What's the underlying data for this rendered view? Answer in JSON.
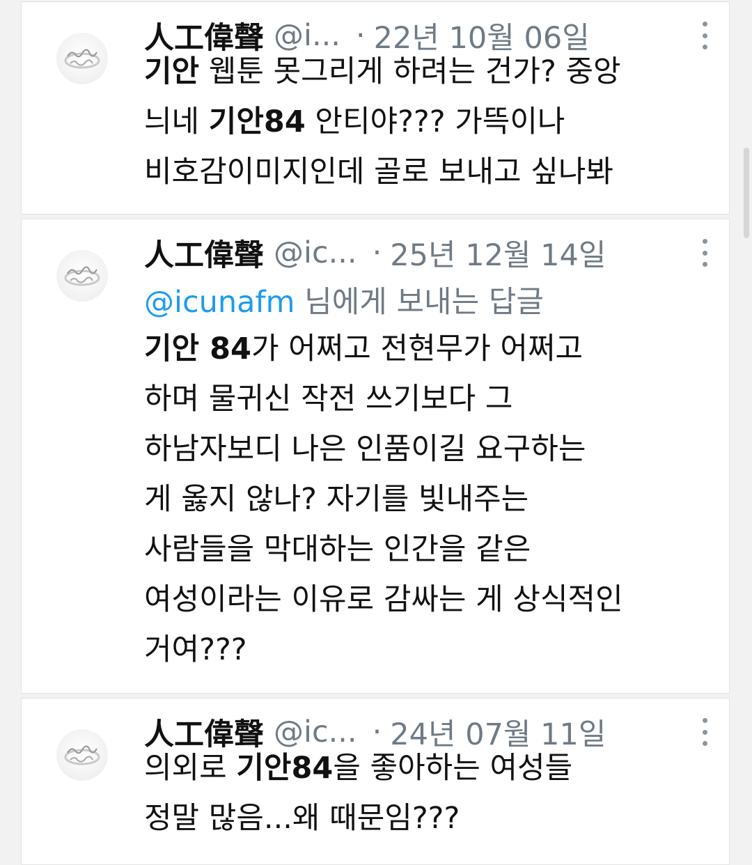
{
  "tweets": [
    {
      "name": "人工偉聲",
      "handle": "@i...",
      "dot": "·",
      "date": "22년 10월 06일",
      "lines": [
        [
          {
            "t": "기안",
            "b": true
          },
          {
            "t": " 웹툰 못그리게 하려는 건가? 중앙",
            "b": false
          }
        ],
        [
          {
            "t": "늬네 ",
            "b": false
          },
          {
            "t": "기안84",
            "b": true
          },
          {
            "t": " 안티야??? 가뜩이나",
            "b": false
          }
        ],
        [
          {
            "t": "비호감이미지인데 골로 보내고 싶나봐",
            "b": false
          }
        ]
      ]
    },
    {
      "name": "人工偉聲",
      "handle": "@ic...",
      "dot": "·",
      "date": "25년 12월 14일",
      "reply_mention": "@icunafm",
      "reply_rest": " 님에게 보내는 답글",
      "lines": [
        [
          {
            "t": "기안 84",
            "b": true
          },
          {
            "t": "가 어쩌고 전현무가 어쩌고",
            "b": false
          }
        ],
        [
          {
            "t": "하며 물귀신 작전 쓰기보다 그",
            "b": false
          }
        ],
        [
          {
            "t": "하남자보디 나은 인품이길  요구하는",
            "b": false
          }
        ],
        [
          {
            "t": "게 옳지 않나? 자기를 빛내주는",
            "b": false
          }
        ],
        [
          {
            "t": "사람들을 막대하는 인간을 같은",
            "b": false
          }
        ],
        [
          {
            "t": "여성이라는 이유로 감싸는 게 상식적인",
            "b": false
          }
        ],
        [
          {
            "t": "거여???",
            "b": false
          }
        ]
      ]
    },
    {
      "name": "人工偉聲",
      "handle": "@ic...",
      "dot": "·",
      "date": "24년 07월 11일",
      "lines": [
        [
          {
            "t": "의외로 ",
            "b": false
          },
          {
            "t": "기안84",
            "b": true
          },
          {
            "t": "을 좋아하는 여성들",
            "b": false
          }
        ],
        [
          {
            "t": "정말 많음...왜 때문임???",
            "b": false
          }
        ]
      ]
    }
  ],
  "colors": {
    "mention": "#1d9bf0",
    "muted": "#6f7a84",
    "text": "#111111"
  },
  "icons": {
    "more": "more-vertical-icon",
    "avatar": "ring-avatar"
  }
}
